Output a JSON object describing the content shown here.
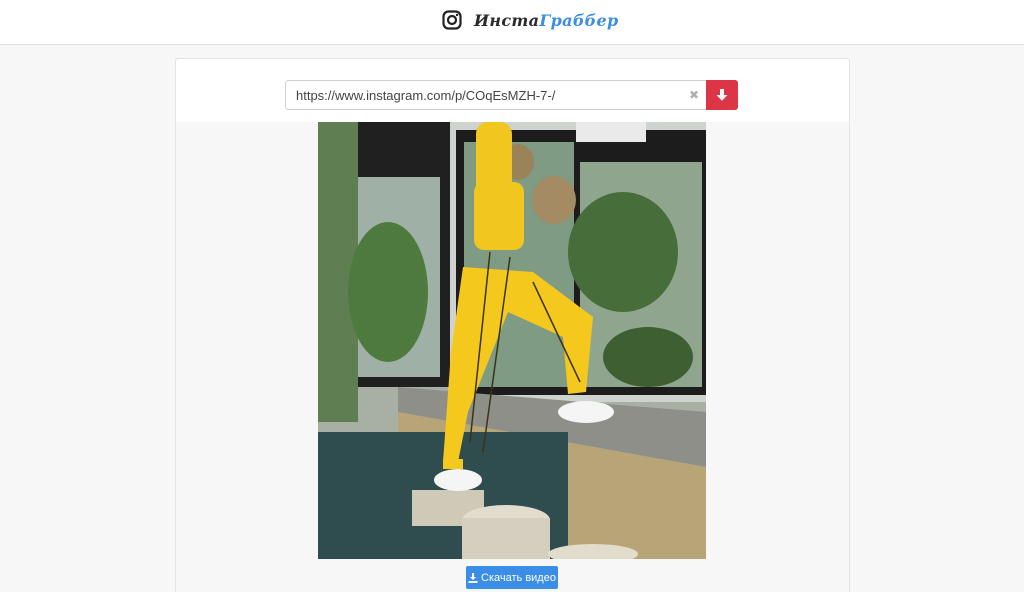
{
  "header": {
    "logo_icon": "instagram-icon",
    "brand_part1": "Инста",
    "brand_part2": "Граббер",
    "brand_color_dark": "#2b2b2b",
    "brand_color_accent": "#3a8ee6"
  },
  "search": {
    "url_value": "https://www.instagram.com/p/COqEsMZH-7-/",
    "clear_icon": "close-icon",
    "clear_symbol": "✖",
    "submit_icon": "arrow-down-icon",
    "submit_color": "#dc3545"
  },
  "media": {
    "type": "photo"
  },
  "actions": {
    "download_video_label": "Скачать видео",
    "download_icon": "download-icon",
    "button_color": "#3a8ee6"
  }
}
